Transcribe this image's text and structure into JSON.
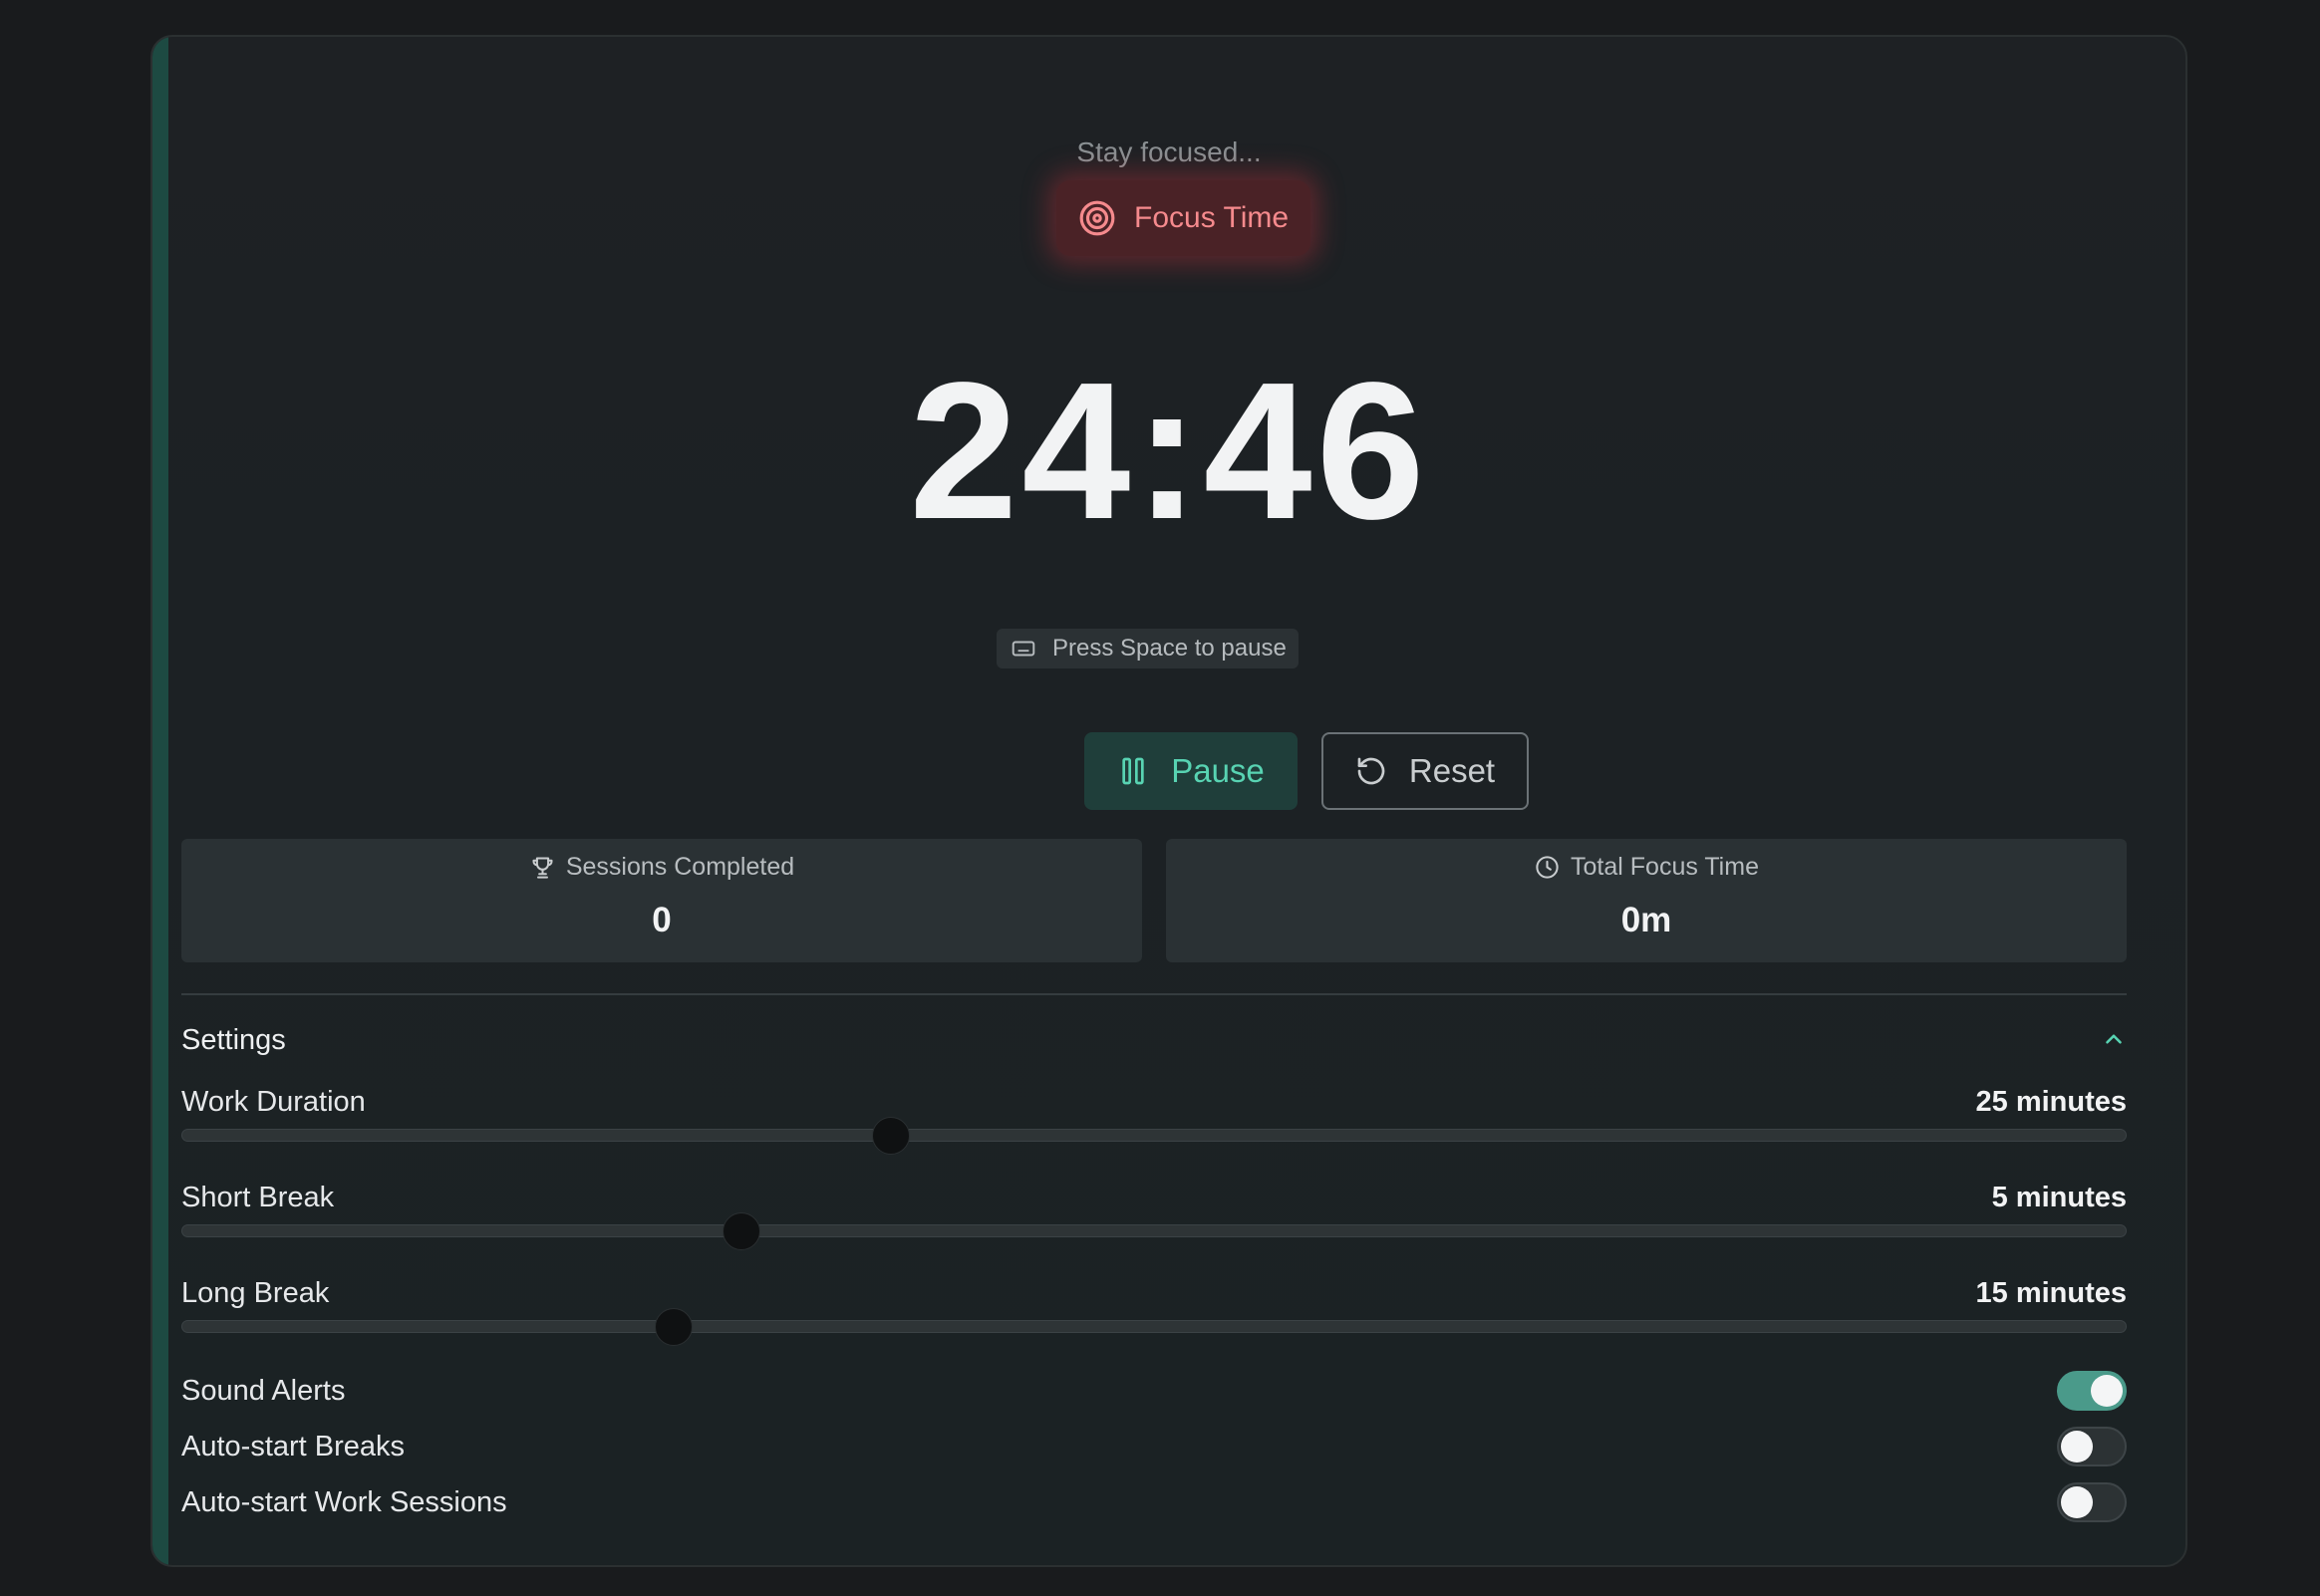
{
  "timer": {
    "status_text": "Stay focused...",
    "mode_label": "Focus Time",
    "time": "24:46",
    "shortcut_hint": "Press Space to pause",
    "pause_label": "Pause",
    "reset_label": "Reset"
  },
  "stats": [
    {
      "label": "Sessions Completed",
      "value": "0",
      "icon": "trophy-icon"
    },
    {
      "label": "Total Focus Time",
      "value": "0m",
      "icon": "clock-icon"
    }
  ],
  "settings": {
    "title": "Settings",
    "expanded": true,
    "sliders": [
      {
        "label": "Work Duration",
        "value_text": "25 minutes",
        "fraction": 0.365
      },
      {
        "label": "Short Break",
        "value_text": "5 minutes",
        "fraction": 0.288
      },
      {
        "label": "Long Break",
        "value_text": "15 minutes",
        "fraction": 0.253
      }
    ],
    "toggles": [
      {
        "label": "Sound Alerts",
        "on": true
      },
      {
        "label": "Auto-start Breaks",
        "on": false
      },
      {
        "label": "Auto-start Work Sessions",
        "on": false
      }
    ]
  },
  "colors": {
    "page_background": "#191b1d",
    "card_accent": "#1d4a42",
    "focus_badge_text": "#f58a8d",
    "primary_accent": "#58d3b2",
    "toggle_on": "#4a9a8a"
  }
}
